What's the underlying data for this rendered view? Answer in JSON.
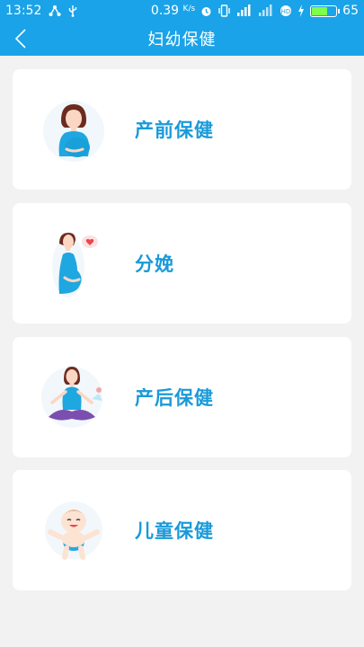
{
  "status_bar": {
    "time": "13:52",
    "speed_value": "0.39",
    "speed_unit": "K/s",
    "battery": "65",
    "battery_level": 0.65
  },
  "header": {
    "title": "妇幼保健",
    "back_icon": "chevron-left-icon"
  },
  "menu": [
    {
      "label": "产前保健",
      "icon": "pregnant-woman-icon"
    },
    {
      "label": "分娩",
      "icon": "expectant-mother-heart-icon"
    },
    {
      "label": "产后保健",
      "icon": "yoga-mother-icon"
    },
    {
      "label": "儿童保健",
      "icon": "baby-icon"
    }
  ],
  "colors": {
    "primary": "#1aa3e8",
    "label": "#1a9ad9",
    "background": "#f2f2f2",
    "card": "#ffffff"
  }
}
